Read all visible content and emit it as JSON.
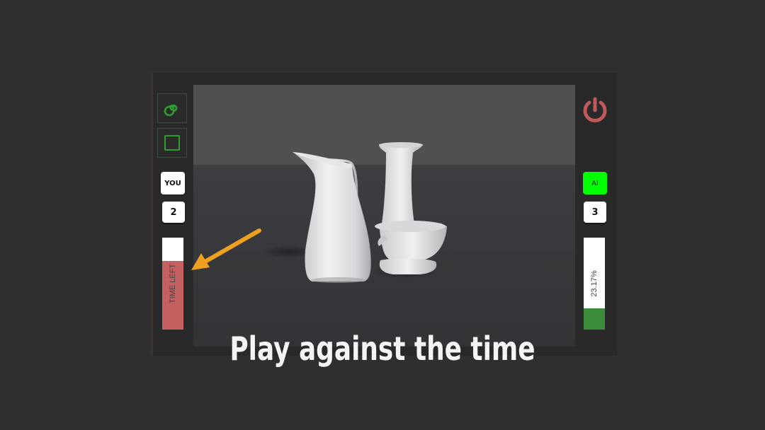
{
  "left_panel": {
    "tools": [
      {
        "icon": "spiral-icon",
        "color": "#2e9e2e"
      },
      {
        "icon": "square-icon",
        "color": "#2e9e2e"
      }
    ],
    "player_label": "YOU",
    "player_score": "2",
    "time_bar": {
      "label": "TIME LEFT",
      "fraction": 0.75,
      "color": "#c46060"
    }
  },
  "right_panel": {
    "power_icon": "power-icon",
    "power_color": "#c05a5a",
    "opponent_label": "AI",
    "opponent_label_color": "#00ff00",
    "opponent_score": "3",
    "progress_bar": {
      "label": "23.17%",
      "fraction": 0.2317,
      "color": "#3c8c3c"
    }
  },
  "scene": {
    "objects": [
      "pitcher",
      "candle-holder"
    ]
  },
  "caption": "Play against the time",
  "annotation": {
    "icon": "arrow-icon",
    "color": "#f0a020"
  }
}
